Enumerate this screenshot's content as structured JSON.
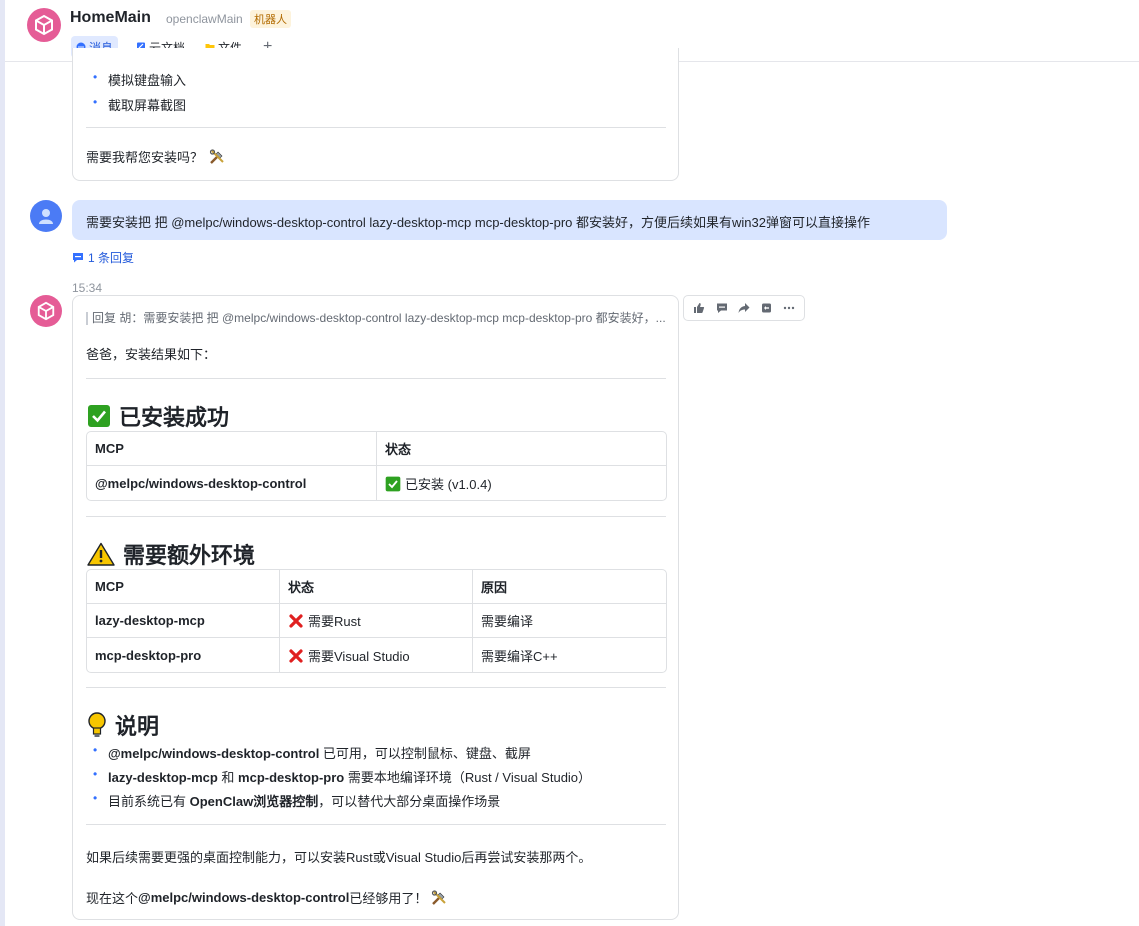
{
  "header": {
    "title": "HomeMain",
    "subtitle": "openclawMain",
    "badge": "机器人",
    "tabs": [
      {
        "label": "消息"
      },
      {
        "label": "云文档"
      },
      {
        "label": "文件"
      }
    ],
    "add": "+"
  },
  "prev_message": {
    "bullets": [
      "模拟键盘输入",
      "截取屏幕截图"
    ],
    "question": "需要我帮您安装吗？"
  },
  "user_message": {
    "text": "需要安装把 把 @melpc/windows-desktop-control  lazy-desktop-mcp mcp-desktop-pro 都安装好，方便后续如果有win32弹窗可以直接操作",
    "reply_count": "1 条回复"
  },
  "bot_message": {
    "time": "15:34",
    "quote": "回复 胡：需要安装把 把 @melpc/windows-desktop-control lazy-desktop-mcp mcp-desktop-pro 都安装好，...",
    "intro": "爸爸，安装结果如下：",
    "section1": {
      "title": "已安装成功",
      "headers": [
        "MCP",
        "状态"
      ],
      "rows": [
        {
          "mcp": "@melpc/windows-desktop-control",
          "status": "已安装 (v1.0.4)"
        }
      ]
    },
    "section2": {
      "title": "需要额外环境",
      "headers": [
        "MCP",
        "状态",
        "原因"
      ],
      "rows": [
        {
          "mcp": "lazy-desktop-mcp",
          "status": "需要Rust",
          "reason": "需要编译"
        },
        {
          "mcp": "mcp-desktop-pro",
          "status": "需要Visual Studio",
          "reason": "需要编译C++"
        }
      ]
    },
    "section3": {
      "title": "说明",
      "b1_bold": "@melpc/windows-desktop-control",
      "b1_rest": " 已可用，可以控制鼠标、键盘、截屏",
      "b2_bold1": "lazy-desktop-mcp",
      "b2_mid": " 和 ",
      "b2_bold2": "mcp-desktop-pro",
      "b2_rest": " 需要本地编译环境（Rust / Visual Studio）",
      "b3_pre": "目前系统已有 ",
      "b3_bold": "OpenClaw浏览器控制",
      "b3_rest": "，可以替代大部分桌面操作场景"
    },
    "outro1": "如果后续需要更强的桌面控制能力，可以安装Rust或Visual Studio后再尝试安装那两个。",
    "outro2_pre": "现在这个 ",
    "outro2_bold": "@melpc/windows-desktop-control",
    "outro2_rest": " 已经够用了！"
  },
  "colors": {
    "accent": "#245bdb",
    "bot_avatar": "#e55c96",
    "user_bubble": "#d9e5ff",
    "check_green": "#2ea121",
    "cross_red": "#e02020",
    "warn_yellow": "#f7c600"
  },
  "icons": [
    "bot-avatar",
    "user-avatar",
    "check-icon",
    "warning-icon",
    "cross-icon",
    "bulb-icon",
    "tools-icon",
    "thumbs-up-icon",
    "comment-icon",
    "forward-icon",
    "pin-icon",
    "more-icon"
  ]
}
